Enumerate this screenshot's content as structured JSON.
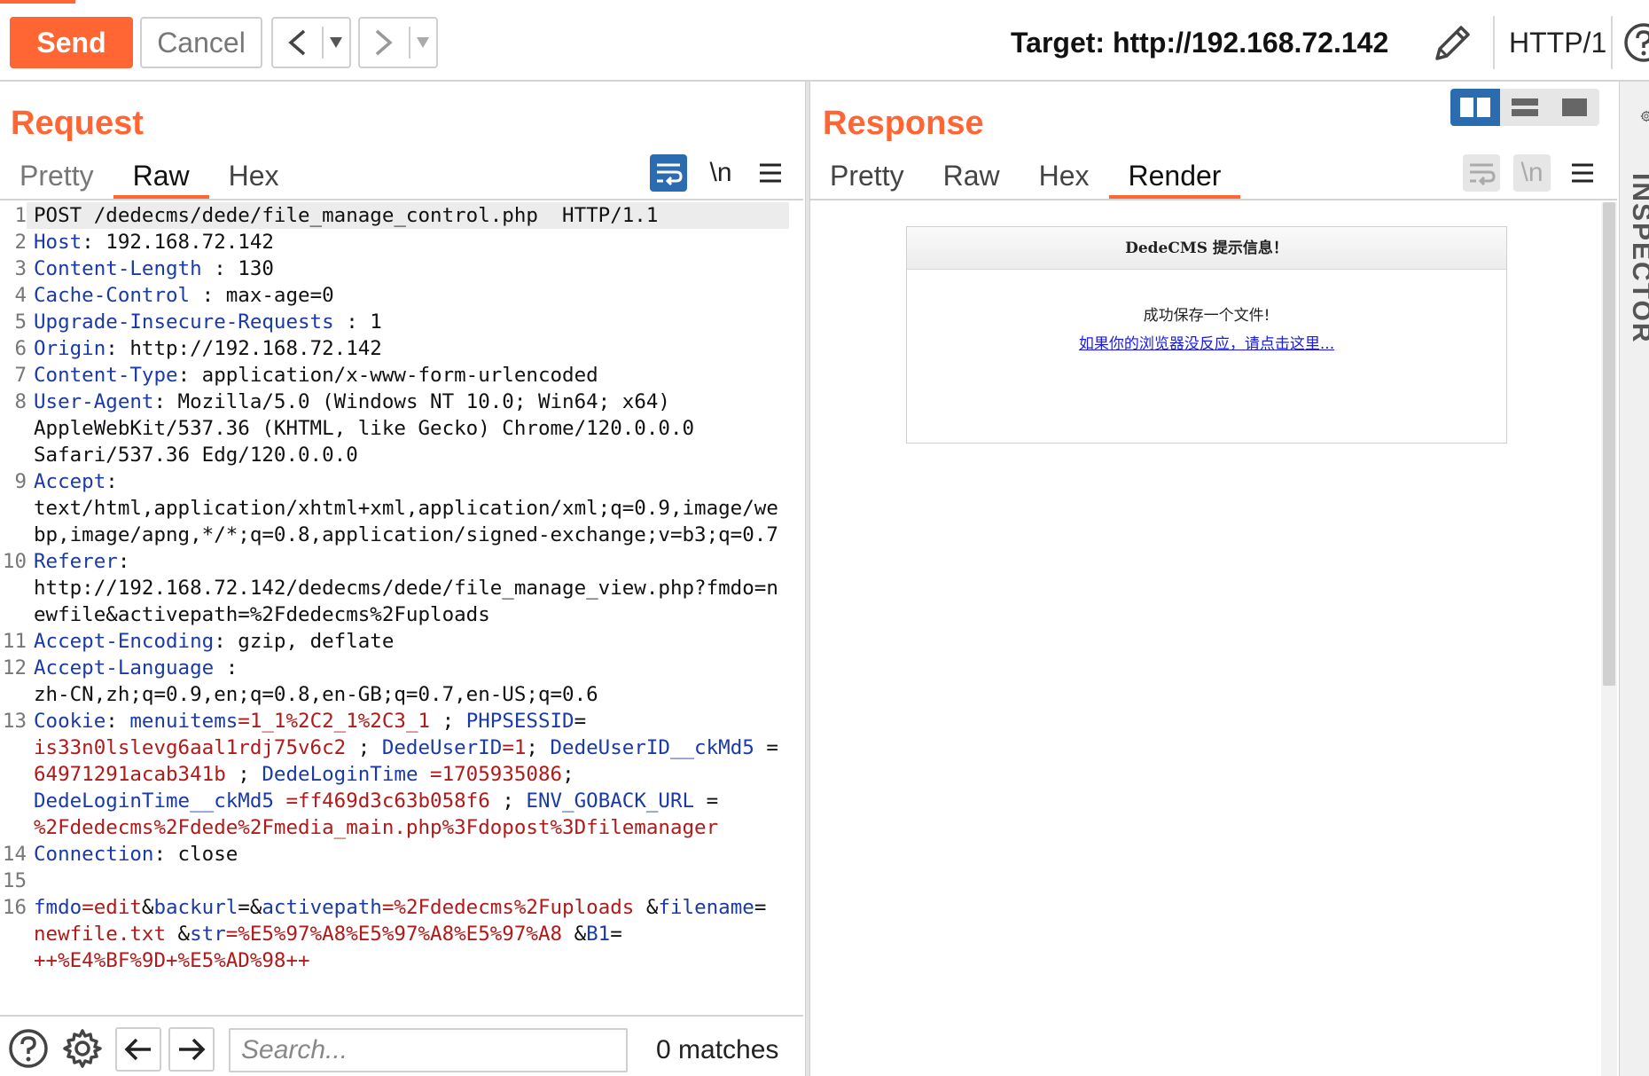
{
  "toolbar": {
    "send_label": "Send",
    "cancel_label": "Cancel",
    "back_label": "<",
    "forward_label": ">",
    "dropdown_glyph": "▾",
    "target_label": "Target: http://192.168.72.142",
    "protocol_label": "HTTP/1",
    "accent_color": "#ff6633"
  },
  "request": {
    "title": "Request",
    "tabs": [
      {
        "label": "Pretty",
        "active": false
      },
      {
        "label": "Raw",
        "active": true
      },
      {
        "label": "Hex",
        "active": false
      }
    ],
    "newline_toggle_label": "\\n",
    "lines": [
      {
        "n": "1",
        "parts": [
          {
            "t": "POST /dedecms/dede/file_manage_control.php  HTTP/1.1",
            "c": ""
          }
        ]
      },
      {
        "n": "2",
        "parts": [
          {
            "t": "Host",
            "c": "hk"
          },
          {
            "t": ": 192.168.72.142",
            "c": ""
          }
        ]
      },
      {
        "n": "3",
        "parts": [
          {
            "t": "Content-Length",
            "c": "hk"
          },
          {
            "t": " : 130",
            "c": ""
          }
        ]
      },
      {
        "n": "4",
        "parts": [
          {
            "t": "Cache-Control",
            "c": "hk"
          },
          {
            "t": " : max-age=0",
            "c": ""
          }
        ]
      },
      {
        "n": "5",
        "parts": [
          {
            "t": "Upgrade-Insecure-Requests",
            "c": "hk"
          },
          {
            "t": " : 1",
            "c": ""
          }
        ]
      },
      {
        "n": "6",
        "parts": [
          {
            "t": "Origin",
            "c": "hk"
          },
          {
            "t": ": http://192.168.72.142",
            "c": ""
          }
        ]
      },
      {
        "n": "7",
        "parts": [
          {
            "t": "Content-Type",
            "c": "hk"
          },
          {
            "t": ": application/x-www-form-urlencoded",
            "c": ""
          }
        ]
      },
      {
        "n": "8",
        "parts": [
          {
            "t": "User-Agent",
            "c": "hk"
          },
          {
            "t": ": Mozilla/5.0 (Windows NT 10.0; Win64; x64)",
            "c": ""
          }
        ]
      },
      {
        "n": "",
        "parts": [
          {
            "t": "AppleWebKit/537.36 (KHTML, like Gecko) Chrome/120.0.0.0",
            "c": ""
          }
        ]
      },
      {
        "n": "",
        "parts": [
          {
            "t": "Safari/537.36 Edg/120.0.0.0",
            "c": ""
          }
        ]
      },
      {
        "n": "9",
        "parts": [
          {
            "t": "Accept",
            "c": "hk"
          },
          {
            "t": ":",
            "c": ""
          }
        ]
      },
      {
        "n": "",
        "parts": [
          {
            "t": "text/html,application/xhtml+xml,application/xml;q=0.9,image/we",
            "c": ""
          }
        ]
      },
      {
        "n": "",
        "parts": [
          {
            "t": "bp,image/apng,*/*;q=0.8,application/signed-exchange;v=b3;q=0.7",
            "c": ""
          }
        ]
      },
      {
        "n": "10",
        "parts": [
          {
            "t": "Referer",
            "c": "hk"
          },
          {
            "t": ":",
            "c": ""
          }
        ]
      },
      {
        "n": "",
        "parts": [
          {
            "t": "http://192.168.72.142/dedecms/dede/file_manage_view.php?fmdo=n",
            "c": ""
          }
        ]
      },
      {
        "n": "",
        "parts": [
          {
            "t": "ewfile&activepath=%2Fdedecms%2Fuploads",
            "c": ""
          }
        ]
      },
      {
        "n": "11",
        "parts": [
          {
            "t": "Accept-Encoding",
            "c": "hk"
          },
          {
            "t": ": gzip, deflate",
            "c": ""
          }
        ]
      },
      {
        "n": "12",
        "parts": [
          {
            "t": "Accept-Language",
            "c": "hk"
          },
          {
            "t": " :",
            "c": ""
          }
        ]
      },
      {
        "n": "",
        "parts": [
          {
            "t": "zh-CN,zh;q=0.9,en;q=0.8,en-GB;q=0.7,en-US;q=0.6",
            "c": ""
          }
        ]
      },
      {
        "n": "13",
        "parts": [
          {
            "t": "Cookie",
            "c": "hk"
          },
          {
            "t": ": ",
            "c": ""
          },
          {
            "t": "menuitems",
            "c": "pk"
          },
          {
            "t": "=1_1%2C2_1%2C3_1",
            "c": "pv"
          },
          {
            "t": " ; ",
            "c": ""
          },
          {
            "t": "PHPSESSID",
            "c": "pk"
          },
          {
            "t": "=",
            "c": ""
          }
        ]
      },
      {
        "n": "",
        "parts": [
          {
            "t": "is33n0lslevg6aal1rdj75v6c2",
            "c": "pv"
          },
          {
            "t": " ; ",
            "c": ""
          },
          {
            "t": "DedeUserID",
            "c": "pk"
          },
          {
            "t": "=1",
            "c": "pv"
          },
          {
            "t": "; ",
            "c": ""
          },
          {
            "t": "DedeUserID__ckMd5",
            "c": "pk"
          },
          {
            "t": " =",
            "c": ""
          }
        ]
      },
      {
        "n": "",
        "parts": [
          {
            "t": "64971291acab341b",
            "c": "pv"
          },
          {
            "t": " ; ",
            "c": ""
          },
          {
            "t": "DedeLoginTime",
            "c": "pk"
          },
          {
            "t": " =1705935086",
            "c": "pv"
          },
          {
            "t": ";",
            "c": ""
          }
        ]
      },
      {
        "n": "",
        "parts": [
          {
            "t": "DedeLoginTime__ckMd5",
            "c": "pk"
          },
          {
            "t": " =ff469d3c63b058f6",
            "c": "pv"
          },
          {
            "t": " ; ",
            "c": ""
          },
          {
            "t": "ENV_GOBACK_URL",
            "c": "pk"
          },
          {
            "t": " =",
            "c": ""
          }
        ]
      },
      {
        "n": "",
        "parts": [
          {
            "t": "%2Fdedecms%2Fdede%2Fmedia_main.php%3Fdopost%3Dfilemanager",
            "c": "pv"
          }
        ]
      },
      {
        "n": "14",
        "parts": [
          {
            "t": "Connection",
            "c": "hk"
          },
          {
            "t": ": close",
            "c": ""
          }
        ]
      },
      {
        "n": "15",
        "parts": [
          {
            "t": "",
            "c": ""
          }
        ]
      },
      {
        "n": "16",
        "parts": [
          {
            "t": "fmdo",
            "c": "pk"
          },
          {
            "t": "=edit",
            "c": "pv"
          },
          {
            "t": "&",
            "c": ""
          },
          {
            "t": "backurl",
            "c": "pk"
          },
          {
            "t": "=&",
            "c": ""
          },
          {
            "t": "activepath",
            "c": "pk"
          },
          {
            "t": "=%2Fdedecms%2Fuploads",
            "c": "pv"
          },
          {
            "t": " &",
            "c": ""
          },
          {
            "t": "filename",
            "c": "pk"
          },
          {
            "t": "=",
            "c": ""
          }
        ]
      },
      {
        "n": "",
        "parts": [
          {
            "t": "newfile.txt",
            "c": "pv"
          },
          {
            "t": " &",
            "c": ""
          },
          {
            "t": "str",
            "c": "pk"
          },
          {
            "t": "=%E5%97%A8%E5%97%A8%E5%97%A8",
            "c": "pv"
          },
          {
            "t": " &",
            "c": ""
          },
          {
            "t": "B1",
            "c": "pk"
          },
          {
            "t": "=",
            "c": ""
          }
        ]
      },
      {
        "n": "",
        "parts": [
          {
            "t": "++%E4%BF%9D+%E5%AD%98++",
            "c": "pv"
          }
        ]
      }
    ]
  },
  "response": {
    "title": "Response",
    "tabs": [
      {
        "label": "Pretty",
        "active": false
      },
      {
        "label": "Raw",
        "active": false
      },
      {
        "label": "Hex",
        "active": false
      },
      {
        "label": "Render",
        "active": true
      }
    ],
    "newline_toggle_label": "\\n",
    "render": {
      "header": "DedeCMS 提示信息！",
      "message": "成功保存一个文件!",
      "link": "如果你的浏览器没反应，请点击这里..."
    }
  },
  "search": {
    "placeholder": "Search...",
    "value": "",
    "matches": "0 matches"
  },
  "inspector": {
    "label": "INSPECTOR"
  }
}
